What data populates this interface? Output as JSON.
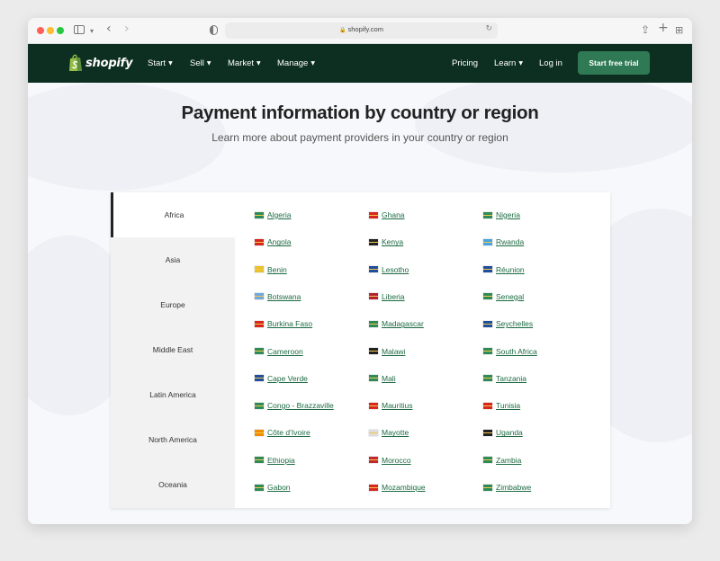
{
  "browser": {
    "url": "shopify.com"
  },
  "nav": {
    "logo_text": "shopify",
    "items": [
      {
        "label": "Start",
        "name": "nav-start"
      },
      {
        "label": "Sell",
        "name": "nav-sell"
      },
      {
        "label": "Market",
        "name": "nav-market"
      },
      {
        "label": "Manage",
        "name": "nav-manage"
      }
    ],
    "pricing": "Pricing",
    "learn": "Learn",
    "login": "Log in",
    "cta": "Start free trial"
  },
  "page": {
    "title": "Payment information by country or region",
    "subtitle": "Learn more about payment providers in your country or region"
  },
  "regions": [
    "Africa",
    "Asia",
    "Europe",
    "Middle East",
    "Latin America",
    "North America",
    "Oceania"
  ],
  "active_region": "Africa",
  "countries": [
    [
      "Algeria",
      "Angola",
      "Benin",
      "Botswana",
      "Burkina Faso",
      "Cameroon",
      "Cape Verde",
      "Congo - Brazzaville",
      "Côte d’Ivoire",
      "Ethiopia",
      "Gabon"
    ],
    [
      "Ghana",
      "Kenya",
      "Lesotho",
      "Liberia",
      "Madagascar",
      "Malawi",
      "Mali",
      "Mauritius",
      "Mayotte",
      "Morocco",
      "Mozambique"
    ],
    [
      "Nigeria",
      "Rwanda",
      "Réunion",
      "Senegal",
      "Seychelles",
      "South Africa",
      "Tanzania",
      "Tunisia",
      "Uganda",
      "Zambia",
      "Zimbabwe"
    ]
  ],
  "flag_colors": [
    [
      "#2e8b57",
      "#d7261e",
      "#e8c22c",
      "#6fa8dc",
      "#d7261e",
      "#2e8b57",
      "#1f4e9c",
      "#2e8b57",
      "#f08c00",
      "#2e8b57",
      "#2e8b57"
    ],
    [
      "#d7261e",
      "#222222",
      "#1f4e9c",
      "#b22234",
      "#2e8b57",
      "#222222",
      "#2e8b57",
      "#d7261e",
      "#dddddd",
      "#c1272d",
      "#d7261e"
    ],
    [
      "#2e8b57",
      "#4aa3df",
      "#1f4e9c",
      "#2e8b57",
      "#1f4e9c",
      "#2e8b57",
      "#2e8b57",
      "#d7261e",
      "#222222",
      "#2e8b57",
      "#2e8b57"
    ]
  ],
  "colors": {
    "nav_bg": "#0d2f21",
    "cta_bg": "#2f7a55",
    "link": "#1c6a42"
  }
}
